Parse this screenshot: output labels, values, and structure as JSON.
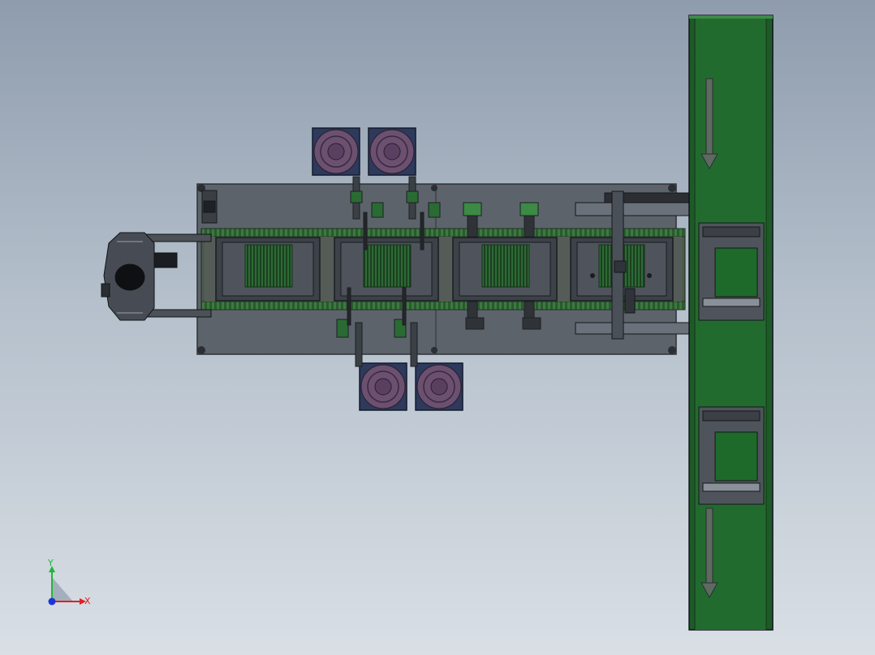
{
  "colors": {
    "background_top": "#8e9cad",
    "background_bottom": "#d9dfe5",
    "base_plate": "#5d636b",
    "frame_dark": "#2e3136",
    "conveyor_green": "#226b2e",
    "conveyor_rail": "#4f8f52",
    "motor_body": "#6b5070",
    "motor_frame": "#2d3a5c",
    "axis_x": "#e02020",
    "axis_y": "#1fb83a",
    "axis_z": "#1c35d6"
  },
  "icons": {
    "flow_arrow": "down-arrow-icon",
    "robot": "robot-gripper-icon",
    "motor": "servo-motor-icon"
  },
  "triad": {
    "x_label": "X",
    "y_label": "Y"
  }
}
